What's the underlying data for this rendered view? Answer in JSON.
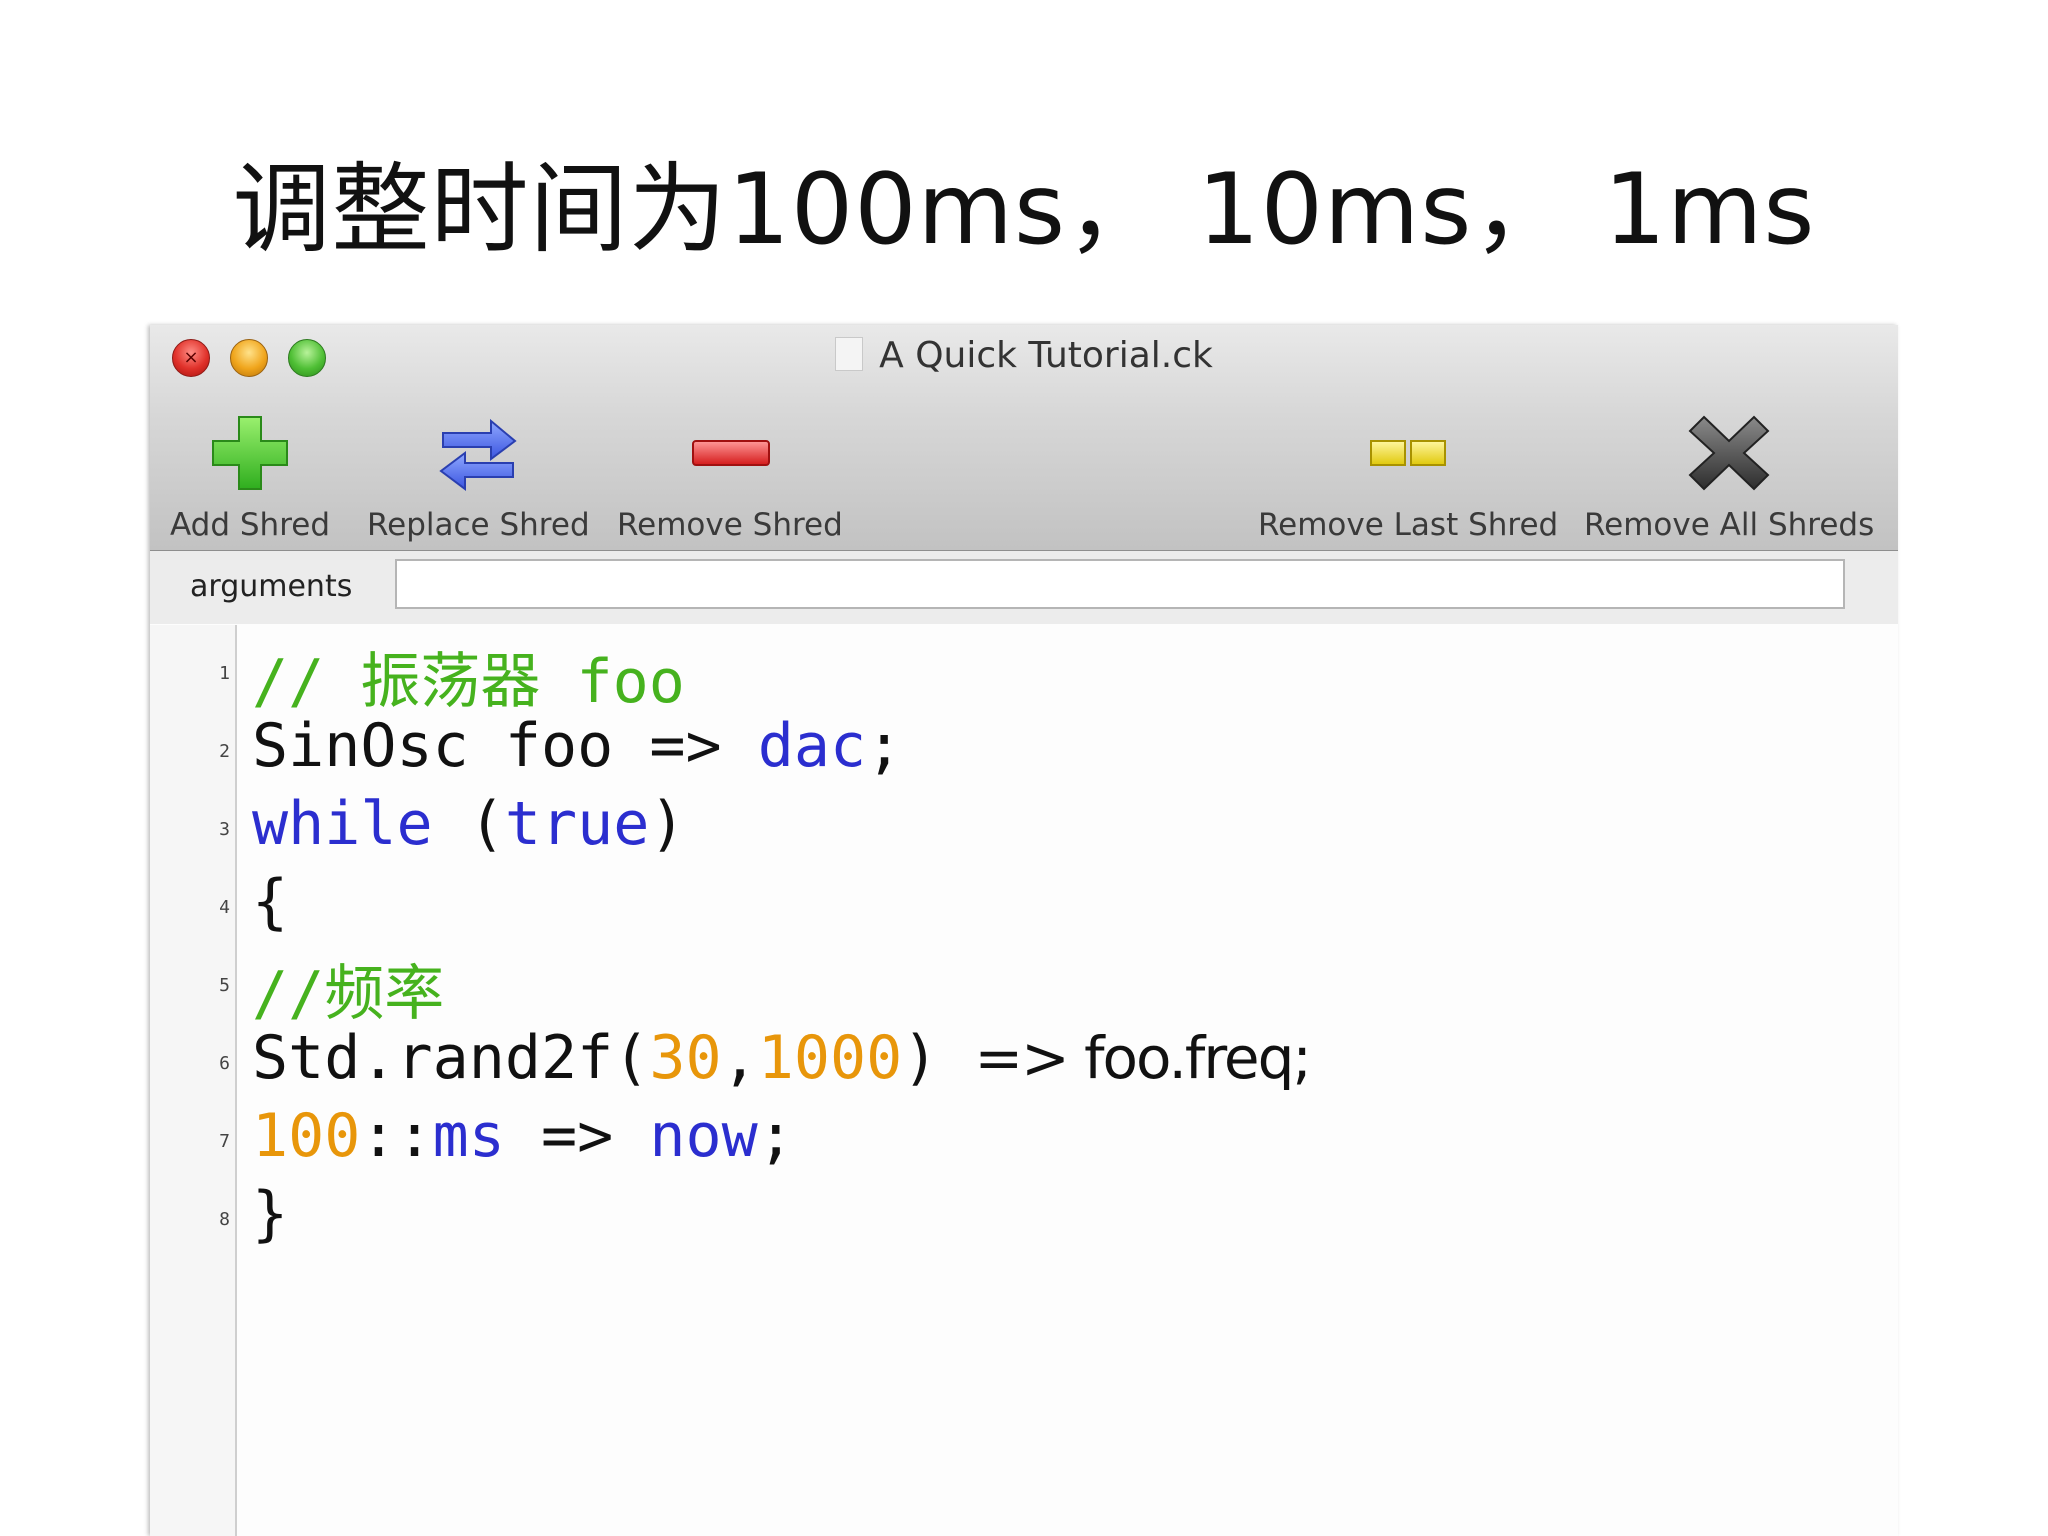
{
  "slide_title": "调整时间为100ms，  10ms，  1ms",
  "window": {
    "title": "A Quick Tutorial.ck"
  },
  "toolbar": {
    "add": "Add Shred",
    "replace": "Replace Shred",
    "remove": "Remove Shred",
    "remove_last": "Remove Last Shred",
    "remove_all": "Remove All Shreds"
  },
  "arguments": {
    "label": "arguments",
    "value": ""
  },
  "code_lines": [
    {
      "n": "1",
      "t0": "// 振荡器 foo"
    },
    {
      "n": "2",
      "t0": "SinOsc foo => ",
      "t1": "dac",
      "t2": ";"
    },
    {
      "n": "3",
      "t0": "while",
      "t1": " (",
      "t2": "true",
      "t3": ")"
    },
    {
      "n": "4",
      "t0": "{"
    },
    {
      "n": "5",
      "t0": "//频率"
    },
    {
      "n": "6",
      "t0": "Std.rand2f(",
      "t1": "30",
      "t2": ",",
      "t3": "1000",
      "t4": ") ",
      "t5": "=> foo.freq;"
    },
    {
      "n": "7",
      "t0": "100",
      "t1": "::",
      "t2": "ms",
      "t3": " => ",
      "t4": "now",
      "t5": ";"
    },
    {
      "n": "8",
      "t0": "}"
    }
  ]
}
